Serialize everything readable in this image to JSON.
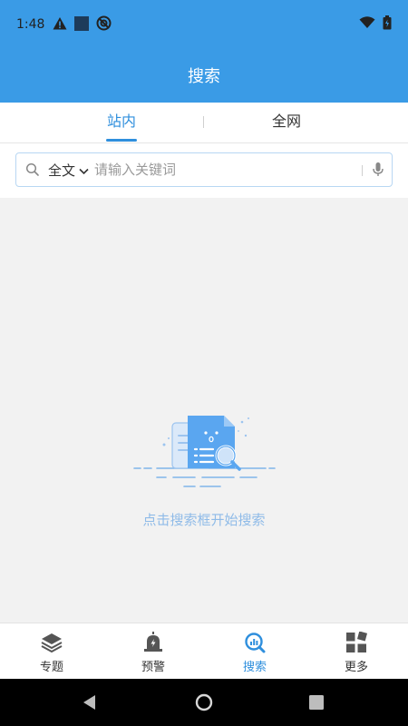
{
  "status_bar": {
    "time": "1:48"
  },
  "app_bar": {
    "title": "搜索"
  },
  "tabs": [
    {
      "label": "站内",
      "active": true
    },
    {
      "label": "全网",
      "active": false
    }
  ],
  "search": {
    "scope_label": "全文",
    "placeholder": "请输入关键词",
    "value": ""
  },
  "empty_state": {
    "message": "点击搜索框开始搜索"
  },
  "bottom_nav": [
    {
      "label": "专题",
      "icon": "layers-icon",
      "active": false
    },
    {
      "label": "预警",
      "icon": "alarm-icon",
      "active": false
    },
    {
      "label": "搜索",
      "icon": "search-chart-icon",
      "active": true
    },
    {
      "label": "更多",
      "icon": "grid-icon",
      "active": false
    }
  ],
  "colors": {
    "primary": "#3a9be6",
    "accent": "#2f8fdd",
    "empty_text": "#8fbbe8",
    "background": "#f2f2f2"
  }
}
